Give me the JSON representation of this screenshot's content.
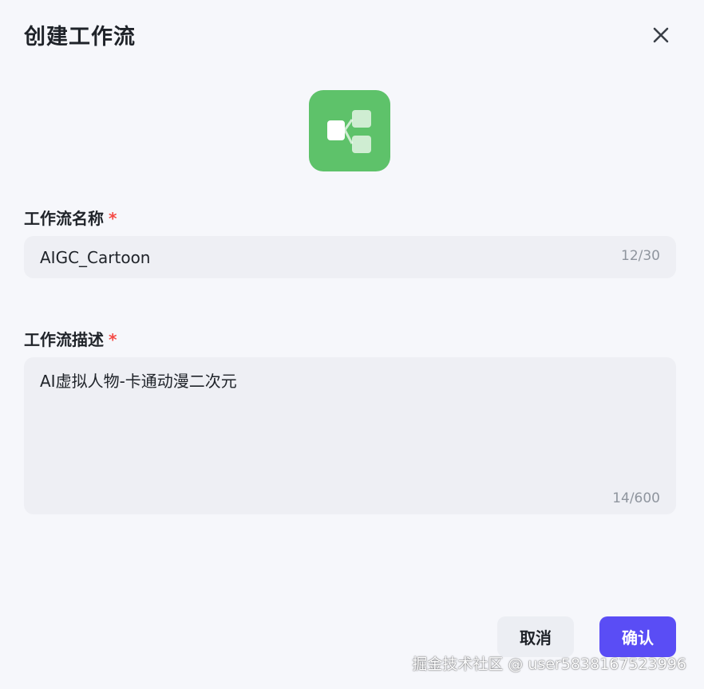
{
  "dialog": {
    "title": "创建工作流",
    "close_icon": "close-icon"
  },
  "workflow_icon": {
    "icon": "workflow-branch-icon",
    "color": "#5ec26a"
  },
  "name_field": {
    "label": "工作流名称",
    "required_mark": "*",
    "value": "AIGC_Cartoon",
    "counter": "12/30"
  },
  "desc_field": {
    "label": "工作流描述",
    "required_mark": "*",
    "value": "AI虚拟人物-卡通动漫二次元",
    "counter": "14/600"
  },
  "footer": {
    "cancel_label": "取消",
    "confirm_label": "确认",
    "confirm_color": "#5a4df5"
  },
  "watermark": "掘金技术社区 @ user5838167523996"
}
